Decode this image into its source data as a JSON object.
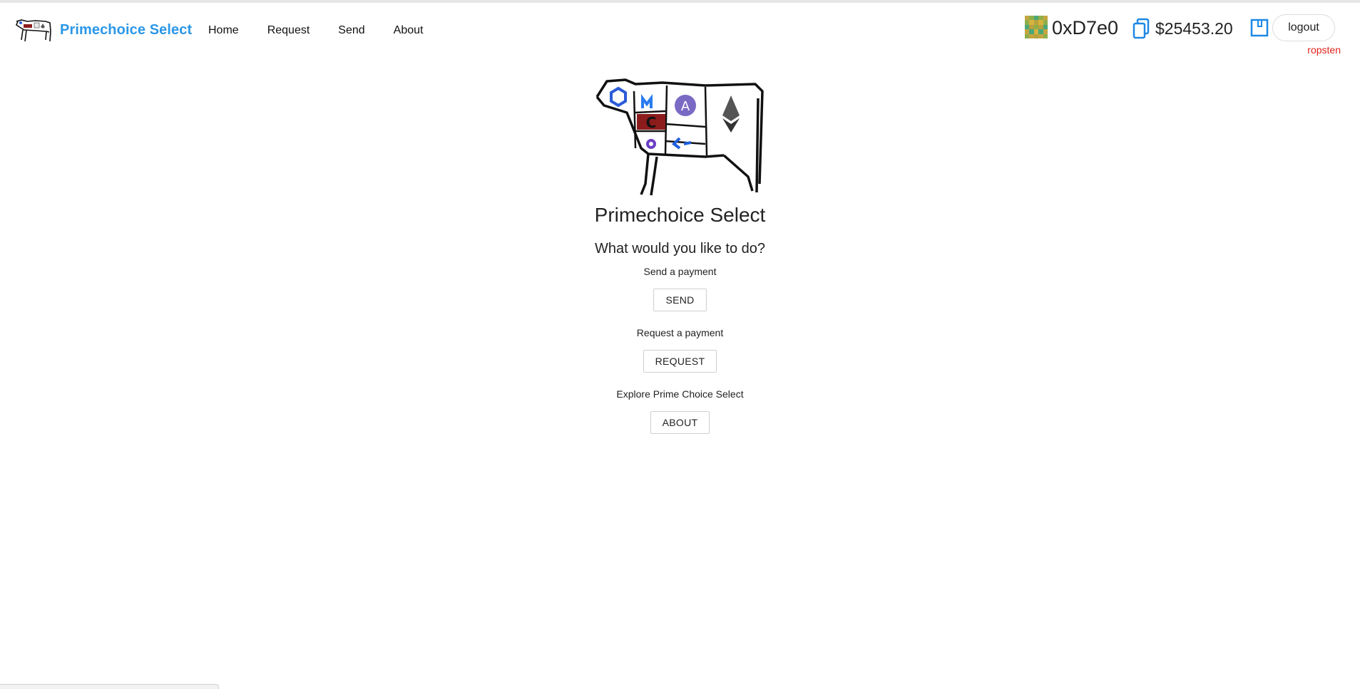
{
  "nav": {
    "brand": "Primechoice Select",
    "links": [
      "Home",
      "Request",
      "Send",
      "About"
    ]
  },
  "account": {
    "address": "0xD7e0",
    "balance": "$25453.20",
    "logout_label": "logout",
    "network": "ropsten",
    "identicon_colors": [
      "#b8a23b",
      "#4aa878",
      "#c4a640",
      "#8fae4a",
      "#d6b33f"
    ]
  },
  "main": {
    "title": "Primechoice Select",
    "question": "What would you like to do?",
    "actions": [
      {
        "text": "Send a payment",
        "button": "SEND"
      },
      {
        "text": "Request a payment",
        "button": "REQUEST"
      },
      {
        "text": "Explore Prime Choice Select",
        "button": "ABOUT"
      }
    ]
  },
  "colors": {
    "brand": "#2b97e8",
    "network": "#e0221a",
    "icon_blue": "#1e88e5",
    "cow_red": "#8c1c1c"
  },
  "icons": [
    "cow-logo-icon",
    "copy-icon",
    "wallet-icon",
    "identicon"
  ]
}
